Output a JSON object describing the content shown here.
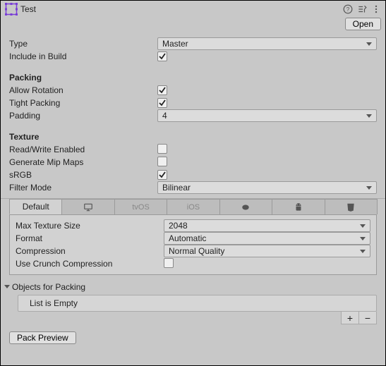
{
  "header": {
    "title": "Test",
    "open_label": "Open"
  },
  "fields": {
    "type_label": "Type",
    "type_value": "Master",
    "include_label": "Include in Build",
    "include_checked": true
  },
  "packing": {
    "title": "Packing",
    "allow_rotation_label": "Allow Rotation",
    "allow_rotation_checked": true,
    "tight_packing_label": "Tight Packing",
    "tight_packing_checked": true,
    "padding_label": "Padding",
    "padding_value": "4"
  },
  "texture": {
    "title": "Texture",
    "rw_label": "Read/Write Enabled",
    "rw_checked": false,
    "mip_label": "Generate Mip Maps",
    "mip_checked": false,
    "srgb_label": "sRGB",
    "srgb_checked": true,
    "filter_label": "Filter Mode",
    "filter_value": "Bilinear"
  },
  "platform": {
    "tabs": {
      "default_label": "Default",
      "tvos_label": "tvOS",
      "ios_label": "iOS"
    },
    "max_size_label": "Max Texture Size",
    "max_size_value": "2048",
    "format_label": "Format",
    "format_value": "Automatic",
    "compression_label": "Compression",
    "compression_value": "Normal Quality",
    "crunch_label": "Use Crunch Compression",
    "crunch_checked": false
  },
  "objects": {
    "title": "Objects for Packing",
    "empty_label": "List is Empty"
  },
  "pack_preview_label": "Pack Preview"
}
